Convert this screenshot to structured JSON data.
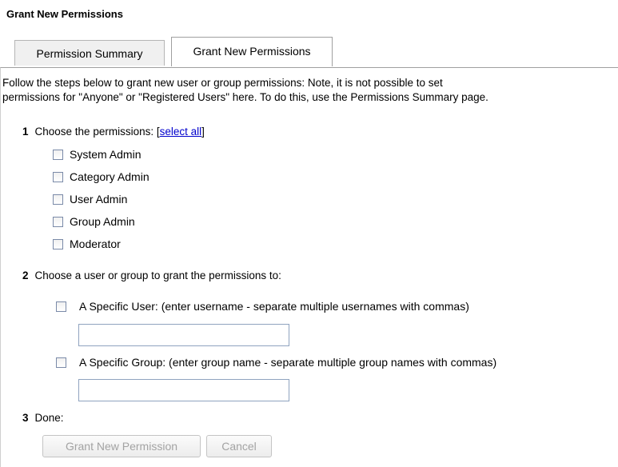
{
  "page": {
    "title": "Grant New Permissions"
  },
  "tabs": [
    {
      "label": "Permission Summary",
      "active": false
    },
    {
      "label": "Grant New Permissions",
      "active": true
    }
  ],
  "intro": {
    "line1": "Follow the steps below to grant new user or group permissions: Note, it is not possible to set",
    "line2": "permissions for \"Anyone\" or \"Registered Users\" here. To do this, use the Permissions Summary page."
  },
  "step1": {
    "number": "1",
    "label": "Choose the permissions: [",
    "select_all_link": "select all",
    "label_end": "]",
    "permissions": [
      {
        "label": "System Admin",
        "checked": false
      },
      {
        "label": "Category Admin",
        "checked": false
      },
      {
        "label": "User Admin",
        "checked": false
      },
      {
        "label": "Group Admin",
        "checked": false
      },
      {
        "label": "Moderator",
        "checked": false
      }
    ]
  },
  "step2": {
    "number": "2",
    "label": "Choose a user or group to grant the permissions to:",
    "specific_user": {
      "label": "A Specific User: (enter username - separate multiple usernames with commas)",
      "checked": false,
      "value": ""
    },
    "specific_group": {
      "label": "A Specific Group: (enter group name - separate multiple group names with commas)",
      "checked": false,
      "value": ""
    }
  },
  "step3": {
    "number": "3",
    "label": "Done:",
    "grant_button": "Grant New Permission",
    "cancel_button": "Cancel"
  },
  "colors": {
    "link": "#0000cc",
    "disabled_button_text": "#a3a3a3",
    "tab_inactive_bg": "#f0f0f0"
  }
}
